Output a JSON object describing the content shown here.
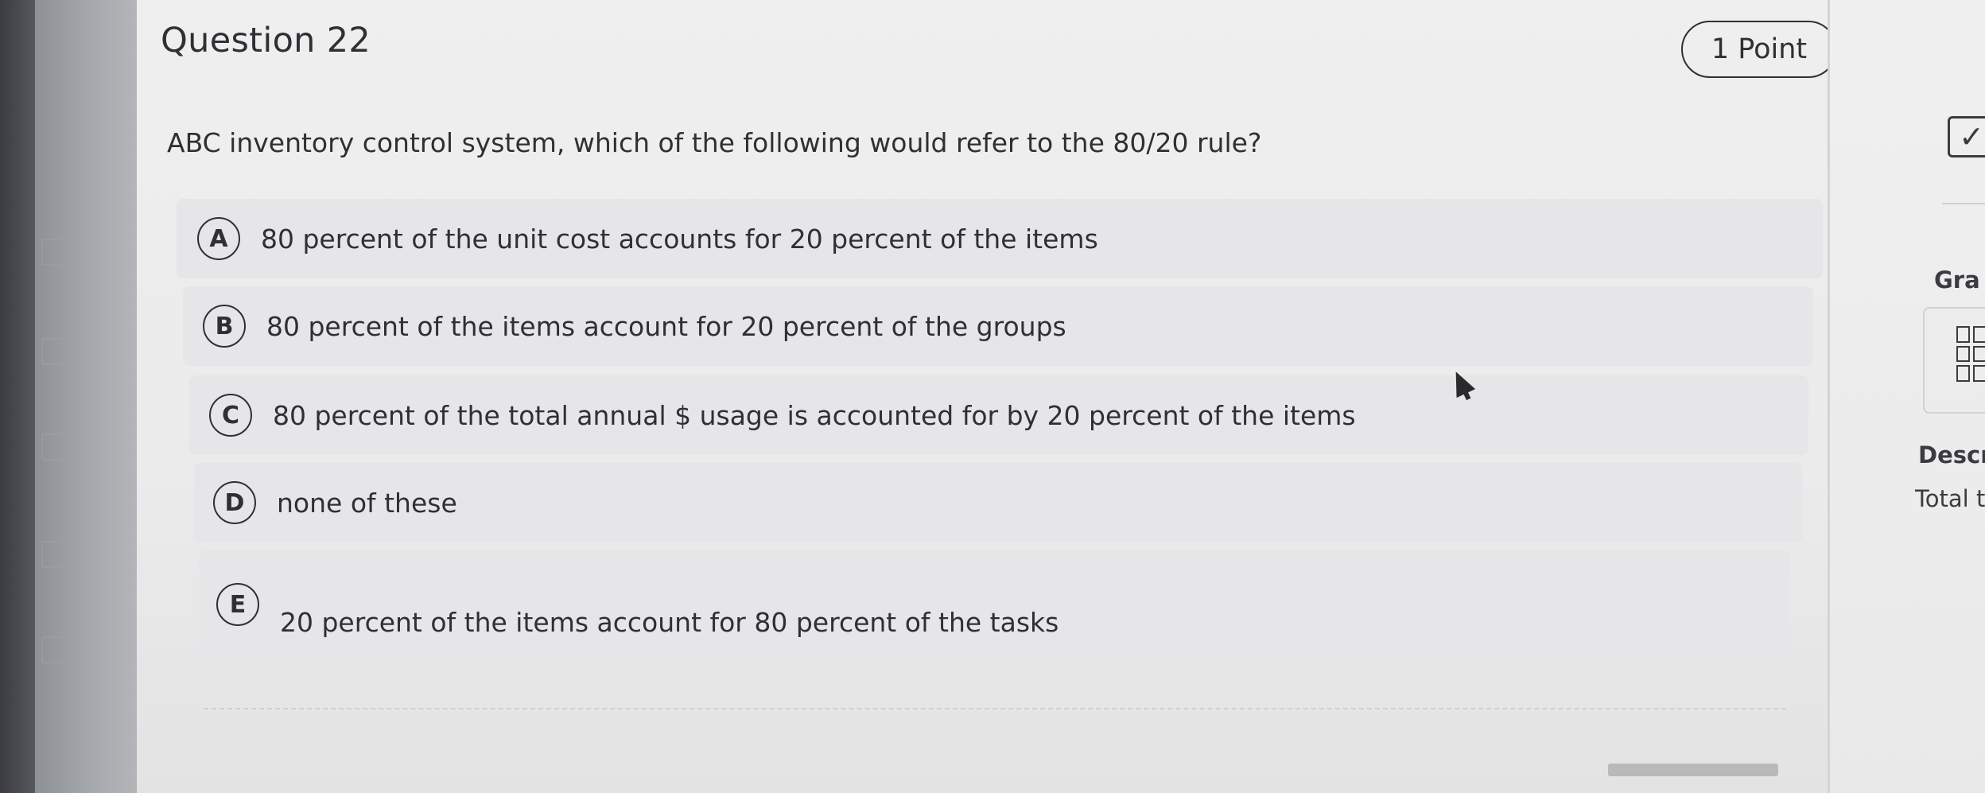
{
  "question": {
    "title": "Question 22",
    "points": "1 Point",
    "text": "ABC inventory control system, which of the following would refer to the 80/20 rule?"
  },
  "options": [
    {
      "letter": "A",
      "text": "80 percent of the unit cost accounts for 20 percent of the items"
    },
    {
      "letter": "B",
      "text": "80 percent of the items account for 20 percent of the groups"
    },
    {
      "letter": "C",
      "text": "80 percent of the total annual $ usage is accounted for by 20 percent of the items"
    },
    {
      "letter": "D",
      "text": "none of these"
    },
    {
      "letter": "E",
      "text": "20 percent of the items account for 80 percent of the tasks"
    }
  ],
  "side_panel": {
    "check_icon": "checkbox-checked-icon",
    "grade_label": "Gra",
    "grid_icon": "grid-icon",
    "desc_label": "Descr",
    "total_label": "Total t"
  },
  "colors": {
    "page_bg": "#efefef",
    "option_bg": "#e6e6e8",
    "text": "#2e3034"
  }
}
